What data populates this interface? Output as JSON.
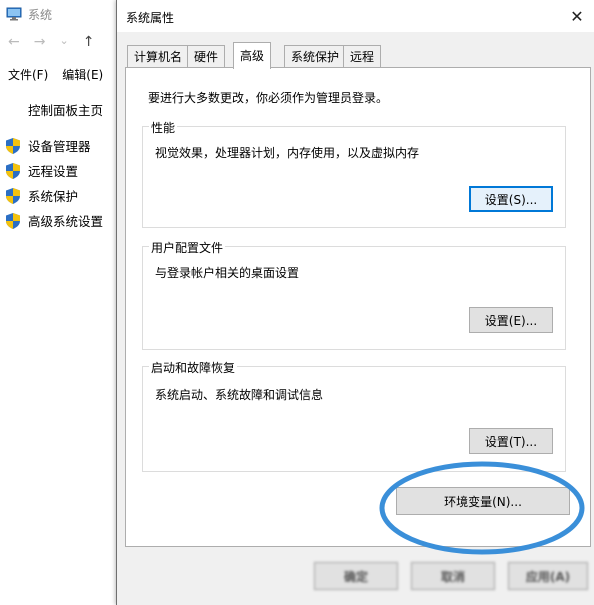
{
  "background_window": {
    "title": "系统",
    "nav": {
      "back": "←",
      "forward": "→",
      "dropdown": "⌄",
      "up": "↑"
    },
    "menu": [
      "文件(F)",
      "编辑(E)"
    ],
    "sidebar": {
      "home": "控制面板主页",
      "items": [
        {
          "label": "设备管理器"
        },
        {
          "label": "远程设置"
        },
        {
          "label": "系统保护"
        },
        {
          "label": "高级系统设置"
        }
      ]
    }
  },
  "dialog": {
    "title": "系统属性",
    "close_glyph": "✕",
    "tabs": [
      {
        "label": "计算机名",
        "active": false
      },
      {
        "label": "硬件",
        "active": false
      },
      {
        "label": "高级",
        "active": true
      },
      {
        "label": "系统保护",
        "active": false
      },
      {
        "label": "远程",
        "active": false
      }
    ],
    "admin_notice": "要进行大多数更改，你必须作为管理员登录。",
    "groups": {
      "performance": {
        "legend": "性能",
        "description": "视觉效果，处理器计划，内存使用，以及虚拟内存",
        "button": "设置(S)..."
      },
      "user_profiles": {
        "legend": "用户配置文件",
        "description": "与登录帐户相关的桌面设置",
        "button": "设置(E)..."
      },
      "startup_recovery": {
        "legend": "启动和故障恢复",
        "description": "系统启动、系统故障和调试信息",
        "button": "设置(T)..."
      }
    },
    "env_button": "环境变量(N)...",
    "bottom_buttons": {
      "ok": "确定",
      "cancel": "取消",
      "apply": "应用(A)"
    }
  },
  "colors": {
    "highlight_ellipse": "#3a8fd9",
    "focus_border": "#0078d7",
    "dialog_bg": "#f0f0f0",
    "panel_bg": "#ffffff"
  },
  "icons": {
    "window_icon": "computer-monitor-icon",
    "shield": "uac-shield-icon",
    "close": "close-icon"
  }
}
